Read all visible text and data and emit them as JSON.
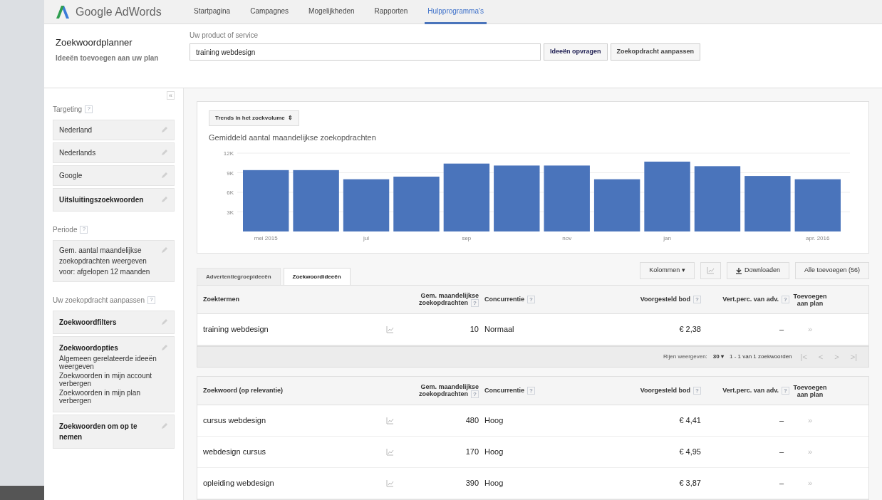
{
  "brand": "Google AdWords",
  "nav": [
    {
      "label": "Startpagina",
      "selected": false
    },
    {
      "label": "Campagnes",
      "selected": false
    },
    {
      "label": "Mogelijkheden",
      "selected": false
    },
    {
      "label": "Rapporten",
      "selected": false
    },
    {
      "label": "Hulpprogramma's",
      "selected": true
    }
  ],
  "planner": {
    "title": "Zoekwoordplanner",
    "subtitle": "Ideeën toevoegen aan uw plan"
  },
  "search": {
    "label": "Uw product of service",
    "value": "training webdesign",
    "buttons": [
      "Ideeën opvragen",
      "Zoekopdracht aanpassen"
    ]
  },
  "sidebar": {
    "collapse": "«",
    "help": "?",
    "sections": [
      {
        "title": "Targeting",
        "items": [
          {
            "kind": "plain",
            "label": "Nederland"
          },
          {
            "kind": "plain",
            "label": "Nederlands"
          },
          {
            "kind": "plain",
            "label": "Google"
          },
          {
            "kind": "bold",
            "label": "Uitsluitingszoekwoorden"
          }
        ]
      },
      {
        "title": "Periode",
        "items": [
          {
            "kind": "plain",
            "label": "Gem. aantal maandelijkse zoekopdrachten weergeven voor: afgelopen 12 maanden"
          }
        ]
      },
      {
        "title": "Uw zoekopdracht aanpassen",
        "items": [
          {
            "kind": "bold",
            "label": "Zoekwoordfilters"
          },
          {
            "kind": "options",
            "label": "Zoekwoordopties",
            "lines": [
              "Algemeen gerelateerde ideeën weergeven",
              "Zoekwoorden in mijn account verbergen",
              "Zoekwoorden in mijn plan verbergen"
            ]
          },
          {
            "kind": "bold",
            "label": "Zoekwoorden om op te nemen"
          }
        ]
      }
    ]
  },
  "chart_panel": {
    "selector": "Trends in het zoekvolume",
    "selector_icon": "⇕",
    "chart_data": {
      "type": "bar",
      "grid": true,
      "title": "Gemiddeld aantal maandelijkse zoekopdrachten",
      "categories": [
        "mei 2015",
        null,
        "jul",
        null,
        "sep",
        null,
        "nov",
        null,
        "jan",
        null,
        null,
        "apr. 2016"
      ],
      "ylim": [
        0,
        12000
      ],
      "yticks": [
        {
          "value": 3000,
          "label": "3K"
        },
        {
          "value": 6000,
          "label": "6K"
        },
        {
          "value": 9000,
          "label": "9K"
        },
        {
          "value": 12000,
          "label": "12K"
        }
      ],
      "series": [
        {
          "color": "#4a74bb",
          "values": [
            9400,
            9400,
            8000,
            8400,
            10400,
            10100,
            10100,
            8000,
            10700,
            10000,
            8500,
            8000
          ]
        }
      ]
    }
  },
  "tabs": [
    {
      "label": "Advertentiegroepideeën",
      "selected": false
    },
    {
      "label": "Zoekwoordideeën",
      "selected": true
    }
  ],
  "toolbar": {
    "columns": "Kolommen ▾",
    "download": "Downloaden",
    "add_all": "Alle toevoegen (56)"
  },
  "columns_search": [
    "Zoektermen",
    "Gem. maandelijkse zoekopdrachten",
    "Concurrentie",
    "Voorgesteld bod",
    "Vert.perc. van adv.",
    "Toevoegen aan plan"
  ],
  "search_rows": [
    {
      "term": "training webdesign",
      "volume": "10",
      "competition": "Normaal",
      "bid": "€ 2,38",
      "share": "–",
      "add": "»"
    }
  ],
  "pager": {
    "label": "Rijen weergeven:",
    "rows": "30 ▾",
    "range": "1 - 1 van 1 zoekwoorden",
    "first": "|<",
    "prev": "<",
    "next": ">",
    "last": ">|"
  },
  "columns_ideas": [
    "Zoekwoord (op relevantie)",
    "Gem. maandelijkse zoekopdrachten",
    "Concurrentie",
    "Voorgesteld bod",
    "Vert.perc. van adv.",
    "Toevoegen aan plan"
  ],
  "idea_rows": [
    {
      "term": "cursus webdesign",
      "volume": "480",
      "competition": "Hoog",
      "bid": "€ 4,41",
      "share": "–",
      "add": "»"
    },
    {
      "term": "webdesign cursus",
      "volume": "170",
      "competition": "Hoog",
      "bid": "€ 4,95",
      "share": "–",
      "add": "»"
    },
    {
      "term": "opleiding webdesign",
      "volume": "390",
      "competition": "Hoog",
      "bid": "€ 3,87",
      "share": "–",
      "add": "»"
    }
  ]
}
